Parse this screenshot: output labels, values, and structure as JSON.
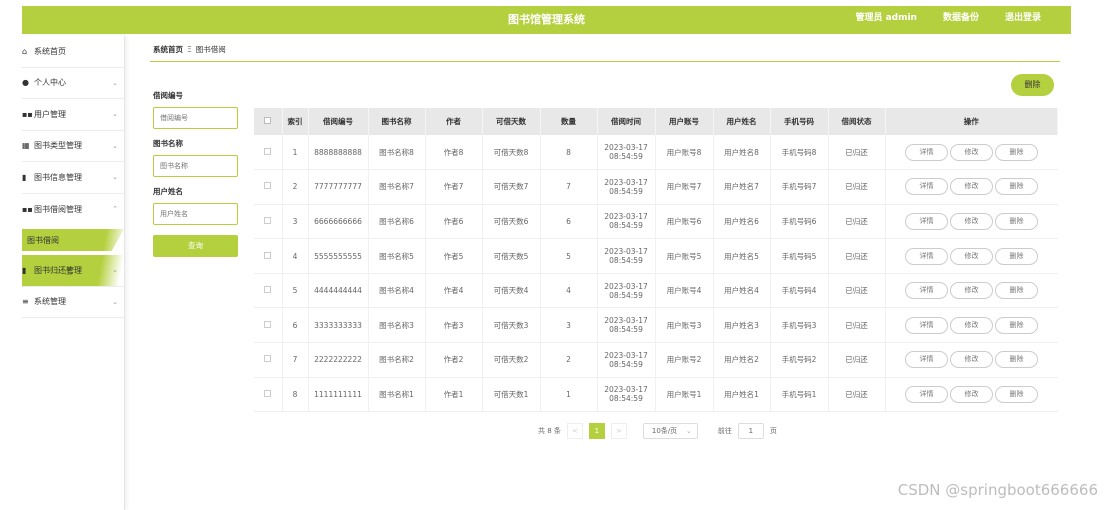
{
  "header": {
    "title": "图书馆管理系统",
    "admin": "管理员 admin",
    "backup": "数据备份",
    "logout": "退出登录"
  },
  "sidebar": {
    "items": [
      {
        "icon": "home-icon",
        "label": "系统首页"
      },
      {
        "icon": "user-icon",
        "label": "个人中心"
      },
      {
        "icon": "grid-icon",
        "label": "用户管理"
      },
      {
        "icon": "grid-icon",
        "label": "图书类型管理"
      },
      {
        "icon": "book-icon",
        "label": "图书信息管理"
      },
      {
        "icon": "grid-icon",
        "label": "图书借阅管理"
      },
      {
        "icon": "book-icon",
        "label": "图书归还管理"
      },
      {
        "icon": "menu-icon",
        "label": "系统管理"
      }
    ],
    "sub_item": "图书借阅"
  },
  "breadcrumb": {
    "home": "系统首页",
    "current": "图书借阅"
  },
  "search": {
    "label1": "借阅编号",
    "placeholder1": "借阅编号",
    "label2": "图书名称",
    "placeholder2": "图书名称",
    "label3": "用户姓名",
    "placeholder3": "用户姓名",
    "button": "查询"
  },
  "delete_button": "删除",
  "table": {
    "headers": [
      "索引",
      "借阅编号",
      "图书名称",
      "作者",
      "可借天数",
      "数量",
      "借阅时间",
      "用户账号",
      "用户姓名",
      "手机号码",
      "借阅状态",
      "操作"
    ],
    "ops": {
      "detail": "详情",
      "edit": "修改",
      "delete": "删除"
    },
    "rows": [
      {
        "idx": "1",
        "no": "8888888888",
        "book": "图书名称8",
        "author": "作者8",
        "days": "可借天数8",
        "qty": "8",
        "date": "2023-03-17",
        "time": "08:54:59",
        "account": "用户账号8",
        "name": "用户姓名8",
        "phone": "手机号码8",
        "status": "已归还"
      },
      {
        "idx": "2",
        "no": "7777777777",
        "book": "图书名称7",
        "author": "作者7",
        "days": "可借天数7",
        "qty": "7",
        "date": "2023-03-17",
        "time": "08:54:59",
        "account": "用户账号7",
        "name": "用户姓名7",
        "phone": "手机号码7",
        "status": "已归还"
      },
      {
        "idx": "3",
        "no": "6666666666",
        "book": "图书名称6",
        "author": "作者6",
        "days": "可借天数6",
        "qty": "6",
        "date": "2023-03-17",
        "time": "08:54:59",
        "account": "用户账号6",
        "name": "用户姓名6",
        "phone": "手机号码6",
        "status": "已归还"
      },
      {
        "idx": "4",
        "no": "5555555555",
        "book": "图书名称5",
        "author": "作者5",
        "days": "可借天数5",
        "qty": "5",
        "date": "2023-03-17",
        "time": "08:54:59",
        "account": "用户账号5",
        "name": "用户姓名5",
        "phone": "手机号码5",
        "status": "已归还"
      },
      {
        "idx": "5",
        "no": "4444444444",
        "book": "图书名称4",
        "author": "作者4",
        "days": "可借天数4",
        "qty": "4",
        "date": "2023-03-17",
        "time": "08:54:59",
        "account": "用户账号4",
        "name": "用户姓名4",
        "phone": "手机号码4",
        "status": "已归还"
      },
      {
        "idx": "6",
        "no": "3333333333",
        "book": "图书名称3",
        "author": "作者3",
        "days": "可借天数3",
        "qty": "3",
        "date": "2023-03-17",
        "time": "08:54:59",
        "account": "用户账号3",
        "name": "用户姓名3",
        "phone": "手机号码3",
        "status": "已归还"
      },
      {
        "idx": "7",
        "no": "2222222222",
        "book": "图书名称2",
        "author": "作者2",
        "days": "可借天数2",
        "qty": "2",
        "date": "2023-03-17",
        "time": "08:54:59",
        "account": "用户账号2",
        "name": "用户姓名2",
        "phone": "手机号码2",
        "status": "已归还"
      },
      {
        "idx": "8",
        "no": "1111111111",
        "book": "图书名称1",
        "author": "作者1",
        "days": "可借天数1",
        "qty": "1",
        "date": "2023-03-17",
        "time": "08:54:59",
        "account": "用户账号1",
        "name": "用户姓名1",
        "phone": "手机号码1",
        "status": "已归还"
      }
    ]
  },
  "pagination": {
    "total": "共 8 条",
    "current_page": "1",
    "page_size": "10条/页",
    "goto_label": "前往",
    "goto_value": "1",
    "page_suffix": "页"
  },
  "watermark": "CSDN @springboot666666",
  "colors": {
    "accent": "#b5d03f"
  }
}
